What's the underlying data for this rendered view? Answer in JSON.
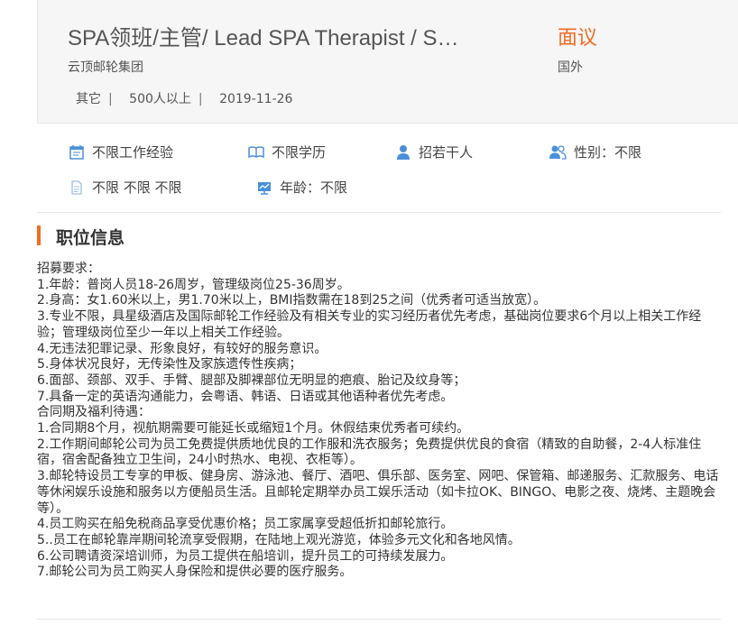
{
  "job": {
    "title": "SPA领班/主管/ Lead SPA Therapist / S…",
    "salary": "面议",
    "company": "云顶邮轮集团",
    "location": "国外",
    "meta": [
      {
        "text": "其它",
        "sep": "|"
      },
      {
        "text": "500人以上",
        "sep": "|"
      },
      {
        "text": "2019-11-26",
        "sep": ""
      }
    ]
  },
  "attributes": {
    "experience": "不限工作经验",
    "education": "不限学历",
    "headcount": "招若干人",
    "gender": "性别：不限",
    "other": "不限 不限 不限",
    "age": "年龄：不限"
  },
  "icons": {
    "experience": "calendar-icon",
    "education": "book-icon",
    "headcount": "person-icon",
    "gender": "users-icon",
    "other": "document-icon",
    "age": "chart-board-icon"
  },
  "colors": {
    "accent": "#f26b21",
    "icon": "#4a90d9"
  },
  "section": {
    "title": "职位信息"
  },
  "description": [
    "招募要求：",
    "1.年龄：普岗人员18-26周岁，管理级岗位25-36周岁。",
    "2.身高：女1.60米以上，男1.70米以上，BMI指数需在18到25之间（优秀者可适当放宽）。",
    "3.专业不限，具星级酒店及国际邮轮工作经验及有相关专业的实习经历者优先考虑，基础岗位要求6个月以上相关工作经验；管理级岗位至少一年以上相关工作经验。",
    "4.无违法犯罪记录、形象良好，有较好的服务意识。",
    "5.身体状况良好，无传染性及家族遗传性疾病；",
    "6.面部、颈部、双手、手臂、腿部及脚裸部位无明显的疤痕、胎记及纹身等；",
    "7.具备一定的英语沟通能力，会粤语、韩语、日语或其他语种者优先考虑。",
    "合同期及福利待遇：",
    "1.合同期8个月，视航期需要可能延长或缩短1个月。休假结束优秀者可续约。",
    "2.工作期间邮轮公司为员工免费提供质地优良的工作服和洗衣服务；免费提供优良的食宿（精致的自助餐，2-4人标准住宿，宿舍配备独立卫生间，24小时热水、电视、衣柜等）。",
    "3.邮轮特设员工专享的甲板、健身房、游泳池、餐厅、酒吧、俱乐部、医务室、网吧、保管箱、邮递服务、汇款服务、电话等休闲娱乐设施和服务以方便船员生活。且邮轮定期举办员工娱乐活动（如卡拉OK、BINGO、电影之夜、烧烤、主题晚会等）。",
    "4.员工购买在船免税商品享受优惠价格；员工家属享受超低折扣邮轮旅行。",
    "5..员工在邮轮靠岸期间轮流享受假期，在陆地上观光游览，体验多元文化和各地风情。",
    "6.公司聘请资深培训师，为员工提供在船培训，提升员工的可持续发展力。",
    "7.邮轮公司为员工购买人身保险和提供必要的医疗服务。"
  ]
}
